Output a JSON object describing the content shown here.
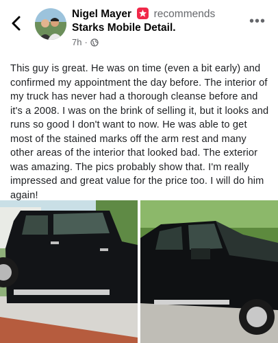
{
  "header": {
    "author": "Nigel Mayer",
    "action": "recommends",
    "page_name": "Starks Mobile Detail.",
    "time": "7h",
    "separator": "·",
    "more_icon": "more-horizontal-icon",
    "back_icon": "chevron-left-icon",
    "privacy_icon": "globe-icon",
    "badge_color": "#f02849"
  },
  "post": {
    "text": "This guy is great. He was on time (even a bit early) and confirmed my appointment the day before.  The interior of my truck has never had a thorough cleanse before and it's a 2008. I was on the brink of selling it, but it looks and runs so good I don't want to now. He was able to get most of the stained marks off the arm rest and many other areas of the interior that looked bad. The exterior was amazing. The pics probably show that. I'm really impressed and great value for the price too. I will do him again!"
  },
  "photos": [
    {
      "name": "truck-photo-side"
    },
    {
      "name": "truck-photo-front"
    }
  ]
}
